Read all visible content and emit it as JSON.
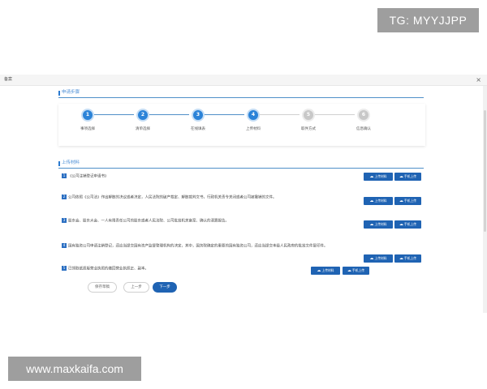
{
  "watermarks": {
    "top_right": "TG: MYYJJPP",
    "bottom_left": "www.maxkaifa.com"
  },
  "window": {
    "title": "备案",
    "close_glyph": "×"
  },
  "section_steps": {
    "title": "申请步骤"
  },
  "steps": [
    {
      "number": "1",
      "label": "事项选择",
      "state": "active"
    },
    {
      "number": "2",
      "label": "清单选择",
      "state": "active"
    },
    {
      "number": "3",
      "label": "在线填表",
      "state": "active"
    },
    {
      "number": "4",
      "label": "上传材料",
      "state": "active"
    },
    {
      "number": "5",
      "label": "取件方式",
      "state": "inactive"
    },
    {
      "number": "6",
      "label": "信息确认",
      "state": "inactive"
    }
  ],
  "section_upload": {
    "title": "上传材料"
  },
  "documents": [
    {
      "number": "1",
      "text": "《公司注销登记申请书》"
    },
    {
      "number": "2",
      "text": "公司依照《公司法》作出解散的决议或者决定，人民法院的破产裁定、解散裁判文书，行政机关责令关闭或者公司被撤销的文件。"
    },
    {
      "number": "3",
      "text": "股东会、股东大会、一人有限责任公司的股东或者人民法院、公司批准机关备案、确认的清算报告。"
    },
    {
      "number": "4",
      "text": "国有独资公司申请注销登记，还应当提交国有资产监督管理机构的决定，其中，国务院确定的重要的国有独资公司，还应当提交本级人民政府的批准文件复印件。"
    },
    {
      "number": "5",
      "text": "已领取纸质版营业执照的缴回营业执照正、副本。"
    }
  ],
  "buttons": {
    "upload": "上传材料",
    "phone_upload": "手机上传",
    "save_draft": "保存草稿",
    "prev": "上一步",
    "next": "下一步"
  },
  "icons": {
    "upload": "cloud-upload-icon",
    "phone_upload": "cloud-upload-icon",
    "close": "close-icon"
  },
  "colors": {
    "accent": "#2b83d8",
    "button": "#1f63b3",
    "inactive": "#c8c8c8",
    "section_line": "#4f8fc8"
  }
}
